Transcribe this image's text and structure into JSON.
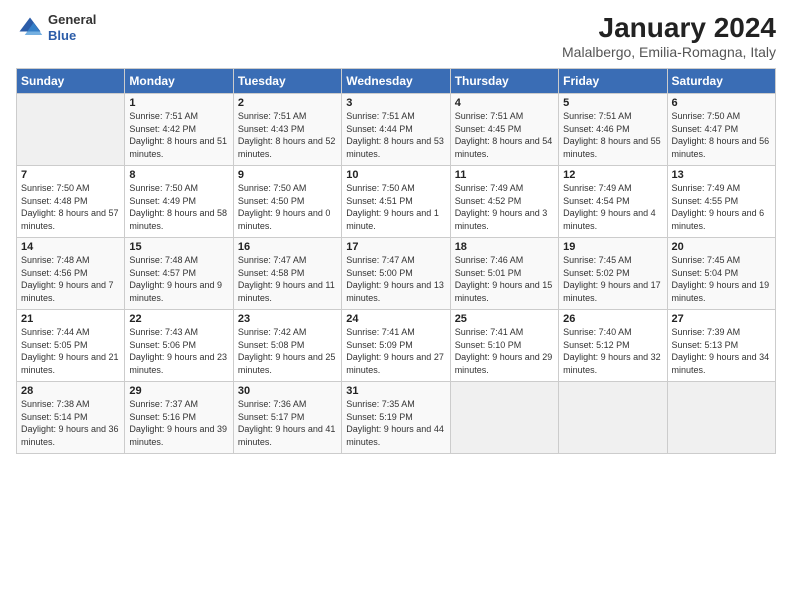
{
  "logo": {
    "line1": "General",
    "line2": "Blue"
  },
  "title": "January 2024",
  "subtitle": "Malalbergo, Emilia-Romagna, Italy",
  "days_of_week": [
    "Sunday",
    "Monday",
    "Tuesday",
    "Wednesday",
    "Thursday",
    "Friday",
    "Saturday"
  ],
  "weeks": [
    [
      {
        "num": "",
        "sunrise": "",
        "sunset": "",
        "daylight": ""
      },
      {
        "num": "1",
        "sunrise": "Sunrise: 7:51 AM",
        "sunset": "Sunset: 4:42 PM",
        "daylight": "Daylight: 8 hours and 51 minutes."
      },
      {
        "num": "2",
        "sunrise": "Sunrise: 7:51 AM",
        "sunset": "Sunset: 4:43 PM",
        "daylight": "Daylight: 8 hours and 52 minutes."
      },
      {
        "num": "3",
        "sunrise": "Sunrise: 7:51 AM",
        "sunset": "Sunset: 4:44 PM",
        "daylight": "Daylight: 8 hours and 53 minutes."
      },
      {
        "num": "4",
        "sunrise": "Sunrise: 7:51 AM",
        "sunset": "Sunset: 4:45 PM",
        "daylight": "Daylight: 8 hours and 54 minutes."
      },
      {
        "num": "5",
        "sunrise": "Sunrise: 7:51 AM",
        "sunset": "Sunset: 4:46 PM",
        "daylight": "Daylight: 8 hours and 55 minutes."
      },
      {
        "num": "6",
        "sunrise": "Sunrise: 7:50 AM",
        "sunset": "Sunset: 4:47 PM",
        "daylight": "Daylight: 8 hours and 56 minutes."
      }
    ],
    [
      {
        "num": "7",
        "sunrise": "Sunrise: 7:50 AM",
        "sunset": "Sunset: 4:48 PM",
        "daylight": "Daylight: 8 hours and 57 minutes."
      },
      {
        "num": "8",
        "sunrise": "Sunrise: 7:50 AM",
        "sunset": "Sunset: 4:49 PM",
        "daylight": "Daylight: 8 hours and 58 minutes."
      },
      {
        "num": "9",
        "sunrise": "Sunrise: 7:50 AM",
        "sunset": "Sunset: 4:50 PM",
        "daylight": "Daylight: 9 hours and 0 minutes."
      },
      {
        "num": "10",
        "sunrise": "Sunrise: 7:50 AM",
        "sunset": "Sunset: 4:51 PM",
        "daylight": "Daylight: 9 hours and 1 minute."
      },
      {
        "num": "11",
        "sunrise": "Sunrise: 7:49 AM",
        "sunset": "Sunset: 4:52 PM",
        "daylight": "Daylight: 9 hours and 3 minutes."
      },
      {
        "num": "12",
        "sunrise": "Sunrise: 7:49 AM",
        "sunset": "Sunset: 4:54 PM",
        "daylight": "Daylight: 9 hours and 4 minutes."
      },
      {
        "num": "13",
        "sunrise": "Sunrise: 7:49 AM",
        "sunset": "Sunset: 4:55 PM",
        "daylight": "Daylight: 9 hours and 6 minutes."
      }
    ],
    [
      {
        "num": "14",
        "sunrise": "Sunrise: 7:48 AM",
        "sunset": "Sunset: 4:56 PM",
        "daylight": "Daylight: 9 hours and 7 minutes."
      },
      {
        "num": "15",
        "sunrise": "Sunrise: 7:48 AM",
        "sunset": "Sunset: 4:57 PM",
        "daylight": "Daylight: 9 hours and 9 minutes."
      },
      {
        "num": "16",
        "sunrise": "Sunrise: 7:47 AM",
        "sunset": "Sunset: 4:58 PM",
        "daylight": "Daylight: 9 hours and 11 minutes."
      },
      {
        "num": "17",
        "sunrise": "Sunrise: 7:47 AM",
        "sunset": "Sunset: 5:00 PM",
        "daylight": "Daylight: 9 hours and 13 minutes."
      },
      {
        "num": "18",
        "sunrise": "Sunrise: 7:46 AM",
        "sunset": "Sunset: 5:01 PM",
        "daylight": "Daylight: 9 hours and 15 minutes."
      },
      {
        "num": "19",
        "sunrise": "Sunrise: 7:45 AM",
        "sunset": "Sunset: 5:02 PM",
        "daylight": "Daylight: 9 hours and 17 minutes."
      },
      {
        "num": "20",
        "sunrise": "Sunrise: 7:45 AM",
        "sunset": "Sunset: 5:04 PM",
        "daylight": "Daylight: 9 hours and 19 minutes."
      }
    ],
    [
      {
        "num": "21",
        "sunrise": "Sunrise: 7:44 AM",
        "sunset": "Sunset: 5:05 PM",
        "daylight": "Daylight: 9 hours and 21 minutes."
      },
      {
        "num": "22",
        "sunrise": "Sunrise: 7:43 AM",
        "sunset": "Sunset: 5:06 PM",
        "daylight": "Daylight: 9 hours and 23 minutes."
      },
      {
        "num": "23",
        "sunrise": "Sunrise: 7:42 AM",
        "sunset": "Sunset: 5:08 PM",
        "daylight": "Daylight: 9 hours and 25 minutes."
      },
      {
        "num": "24",
        "sunrise": "Sunrise: 7:41 AM",
        "sunset": "Sunset: 5:09 PM",
        "daylight": "Daylight: 9 hours and 27 minutes."
      },
      {
        "num": "25",
        "sunrise": "Sunrise: 7:41 AM",
        "sunset": "Sunset: 5:10 PM",
        "daylight": "Daylight: 9 hours and 29 minutes."
      },
      {
        "num": "26",
        "sunrise": "Sunrise: 7:40 AM",
        "sunset": "Sunset: 5:12 PM",
        "daylight": "Daylight: 9 hours and 32 minutes."
      },
      {
        "num": "27",
        "sunrise": "Sunrise: 7:39 AM",
        "sunset": "Sunset: 5:13 PM",
        "daylight": "Daylight: 9 hours and 34 minutes."
      }
    ],
    [
      {
        "num": "28",
        "sunrise": "Sunrise: 7:38 AM",
        "sunset": "Sunset: 5:14 PM",
        "daylight": "Daylight: 9 hours and 36 minutes."
      },
      {
        "num": "29",
        "sunrise": "Sunrise: 7:37 AM",
        "sunset": "Sunset: 5:16 PM",
        "daylight": "Daylight: 9 hours and 39 minutes."
      },
      {
        "num": "30",
        "sunrise": "Sunrise: 7:36 AM",
        "sunset": "Sunset: 5:17 PM",
        "daylight": "Daylight: 9 hours and 41 minutes."
      },
      {
        "num": "31",
        "sunrise": "Sunrise: 7:35 AM",
        "sunset": "Sunset: 5:19 PM",
        "daylight": "Daylight: 9 hours and 44 minutes."
      },
      {
        "num": "",
        "sunrise": "",
        "sunset": "",
        "daylight": ""
      },
      {
        "num": "",
        "sunrise": "",
        "sunset": "",
        "daylight": ""
      },
      {
        "num": "",
        "sunrise": "",
        "sunset": "",
        "daylight": ""
      }
    ]
  ]
}
